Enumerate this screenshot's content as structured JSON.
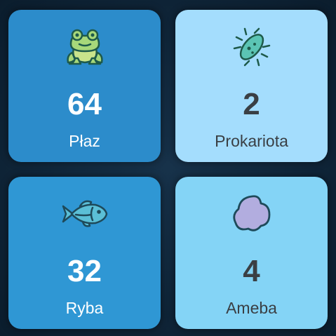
{
  "tiles": [
    {
      "count": "64",
      "label": "Płaz",
      "icon": "frog-icon",
      "bg": "#2c8ccb",
      "fg": "#ffffff"
    },
    {
      "count": "2",
      "label": "Prokariota",
      "icon": "bacterium-icon",
      "bg": "#a4ddfd",
      "fg": "#3a3f44"
    },
    {
      "count": "32",
      "label": "Ryba",
      "icon": "fish-icon",
      "bg": "#2f97d4",
      "fg": "#ffffff"
    },
    {
      "count": "4",
      "label": "Ameba",
      "icon": "amoeba-icon",
      "bg": "#84d4f6",
      "fg": "#3a3f44"
    }
  ]
}
